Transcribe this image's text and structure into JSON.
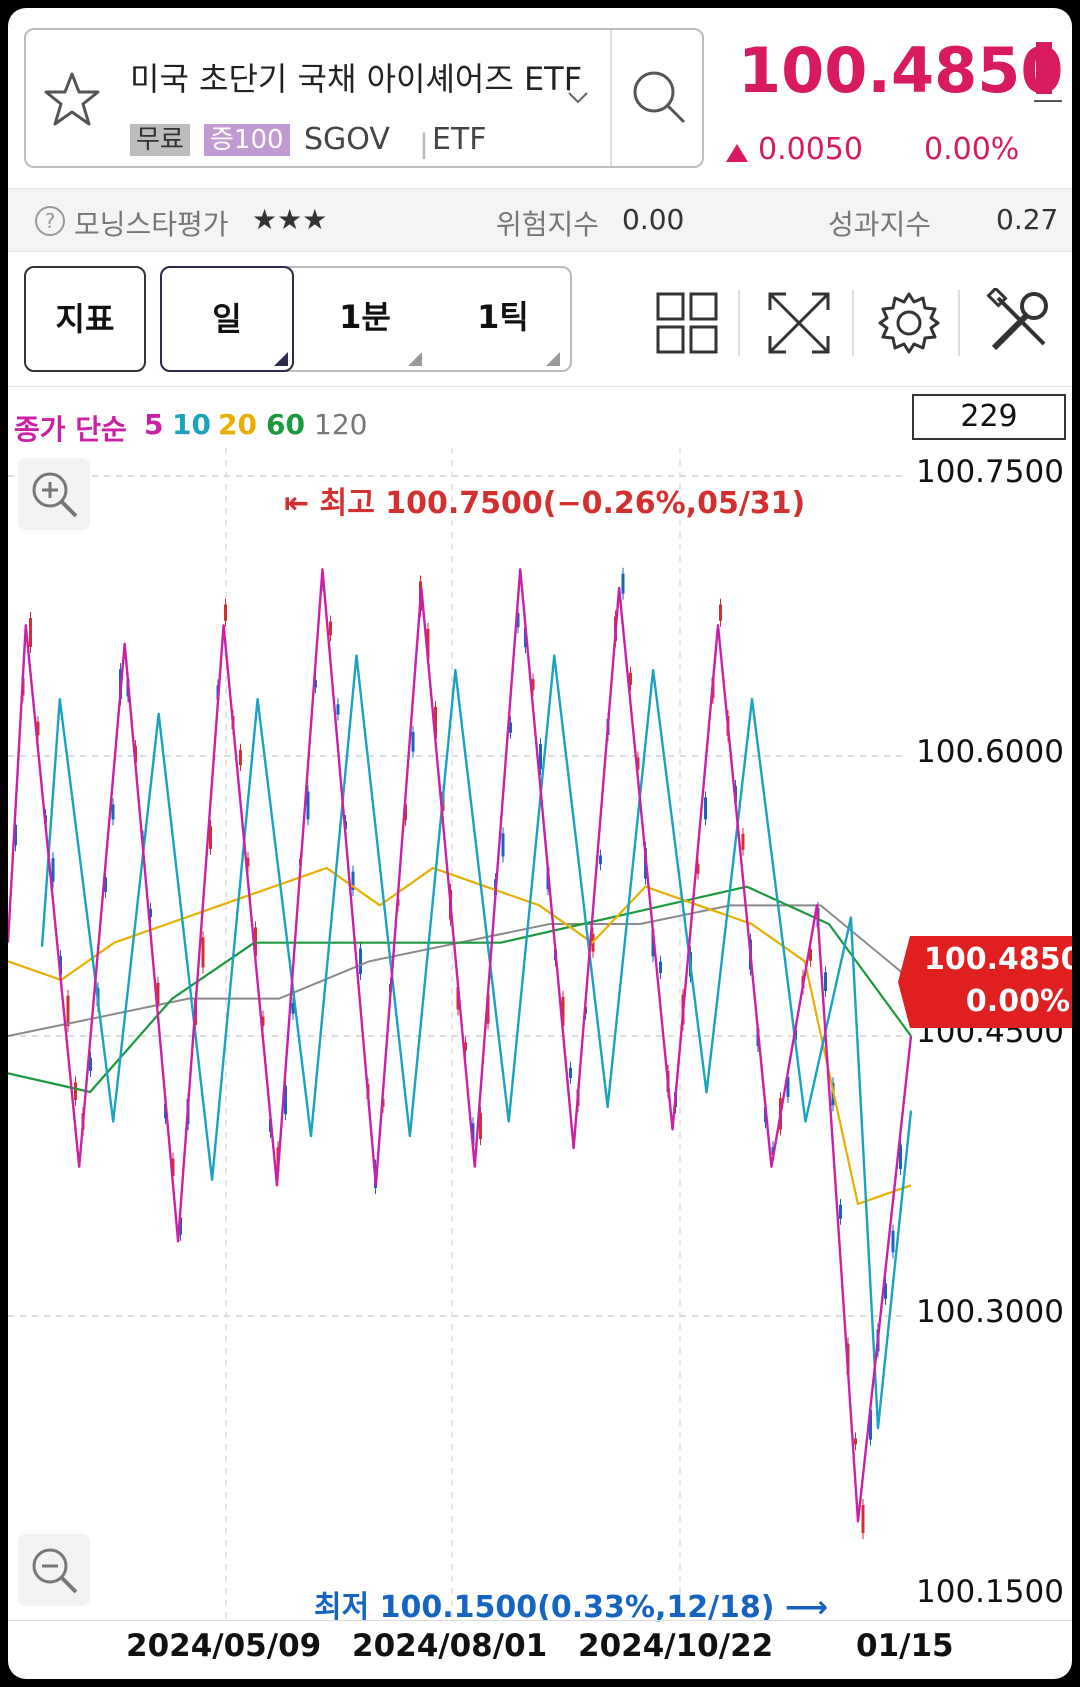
{
  "header": {
    "title": "미국 초단기 국채 아이셰어즈 ETF",
    "badge_free": "무료",
    "badge_margin": "증100",
    "ticker": "SGOV",
    "sep": "ㅣ",
    "type": "ETF"
  },
  "price": {
    "current": "100.4850",
    "change": "0.0050",
    "change_pct": "0.00%"
  },
  "info": {
    "rating_label": "모닝스타평가",
    "rating_stars": "★★★",
    "risk_label": "위험지수",
    "risk_value": "0.00",
    "perf_label": "성과지수",
    "perf_value": "0.27"
  },
  "toolbar": {
    "indicator": "지표",
    "day": "일",
    "minute": "1분",
    "tick": "1틱"
  },
  "ma_legend": {
    "prefix": "종가 단순",
    "p5": "5",
    "p10": "10",
    "p20": "20",
    "p60": "60",
    "p120": "120",
    "count": "229"
  },
  "colors": {
    "up": "#d32f2f",
    "down": "#1565c0",
    "ma5": "#cc1fa8",
    "ma10": "#1aa3c0",
    "ma20": "#e6b000",
    "ma60": "#1b9a3c",
    "ma120": "#8a8a8a",
    "accent": "#d81b60"
  },
  "chart_data": {
    "type": "line",
    "y_ticks": [
      "100.7500",
      "100.6000",
      "100.4500",
      "100.3000",
      "100.1500"
    ],
    "ylim": [
      100.15,
      100.75
    ],
    "x_ticks": [
      "2024/05/09",
      "2024/08/01",
      "2024/10/22",
      "01/15"
    ],
    "high_annotation": "최고 100.7500(−0.26%,05/31)",
    "low_annotation": "최저 100.1500(0.33%,12/18)",
    "last_price_label": "100.4850",
    "last_pct_label": "0.00%",
    "series": [
      {
        "name": "5",
        "peaks": [
          100.67,
          100.66,
          100.67,
          100.7,
          100.69,
          100.7,
          100.69,
          100.67,
          100.52
        ]
      },
      {
        "name": "10",
        "peaks": [
          100.6,
          100.62,
          100.63,
          100.63,
          100.64,
          100.63,
          100.63,
          100.58
        ]
      },
      {
        "name": "20",
        "points": [
          100.49,
          100.48,
          100.5,
          100.51,
          100.52,
          100.53,
          100.54,
          100.52,
          100.54,
          100.53,
          100.52,
          100.5,
          100.53,
          100.52,
          100.51,
          100.49,
          100.36,
          100.37
        ]
      },
      {
        "name": "60",
        "points": [
          100.43,
          100.42,
          100.47,
          100.5,
          100.5,
          100.5,
          100.5,
          100.51,
          100.52,
          100.53,
          100.51,
          100.45
        ]
      },
      {
        "name": "120",
        "points": [
          100.45,
          100.46,
          100.47,
          100.47,
          100.49,
          100.5,
          100.51,
          100.51,
          100.52,
          100.52,
          100.48
        ]
      }
    ]
  }
}
